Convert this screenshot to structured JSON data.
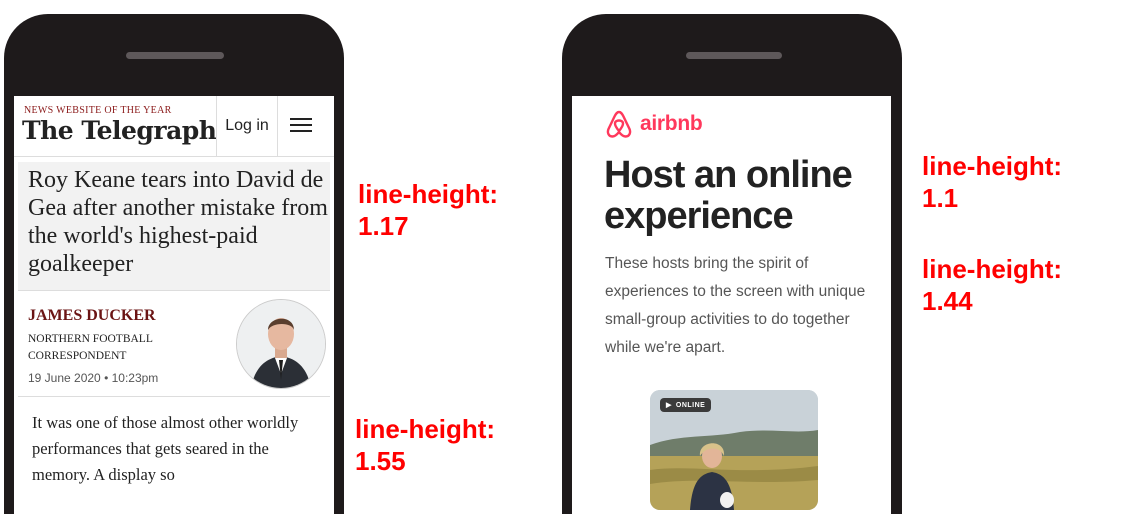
{
  "telegraph": {
    "tagline": "NEWS WEBSITE OF THE YEAR",
    "logo": "The Telegraph",
    "login_label": "Log in",
    "headline": "Roy Keane tears into David de Gea after another mistake from the world's highest-paid goalkeeper",
    "author": "JAMES DUCKER",
    "author_role": "NORTHERN FOOTBALL CORRESPONDENT",
    "date": "19 June 2020 • 10:23pm",
    "body": "It was one of those almost other worldly performances that gets seared in the memory. A display so"
  },
  "airbnb": {
    "wordmark": "airbnb",
    "title": "Host an online experience",
    "description": "These hosts bring the spirit of experiences to the screen with unique small-group activities to do together while we're apart.",
    "badge": "ONLINE",
    "brand_color": "#ff385c"
  },
  "annotations": {
    "a1_label": "line-height:",
    "a1_value": "1.17",
    "a2_label": "line-height:",
    "a2_value": "1.55",
    "a3_label": "line-height:",
    "a3_value": "1.1",
    "a4_label": "line-height:",
    "a4_value": "1.44",
    "color": "#ff0000"
  }
}
